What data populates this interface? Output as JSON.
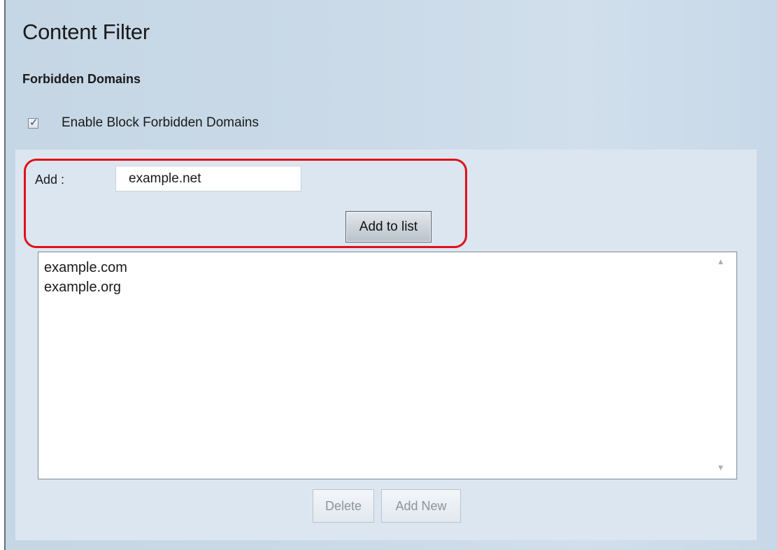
{
  "page": {
    "title": "Content Filter",
    "section_title": "Forbidden Domains"
  },
  "enable_block": {
    "label": "Enable Block Forbidden Domains",
    "checked": true
  },
  "add_form": {
    "label": "Add :",
    "input_value": "example.net",
    "button_label": "Add to list"
  },
  "domain_list": {
    "items": [
      "example.com",
      "example.org"
    ]
  },
  "actions": {
    "delete_label": "Delete",
    "add_new_label": "Add New"
  },
  "colors": {
    "highlight": "#e0101a",
    "panel": "#dce6f0"
  },
  "icons": {
    "checkbox_mark": "✓",
    "scroll_up": "▲",
    "scroll_down": "▼"
  }
}
